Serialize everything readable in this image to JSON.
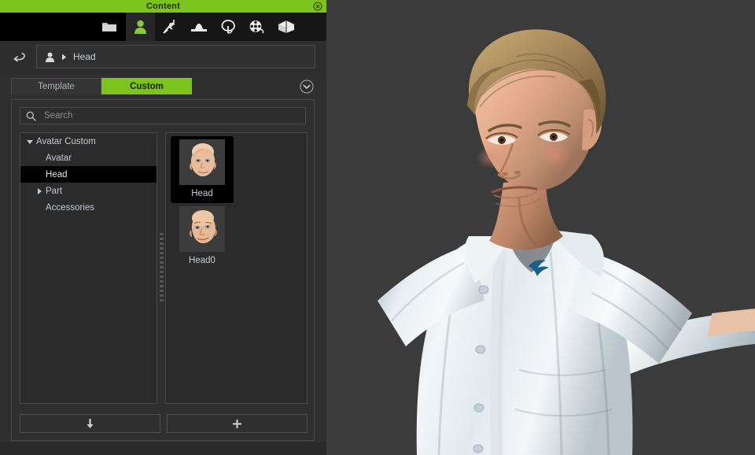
{
  "window": {
    "title": "Content",
    "close_icon": "close-circle-icon"
  },
  "toolbar": {
    "items": [
      {
        "name": "folder",
        "icon": "folder-icon",
        "label": "Folder",
        "active": false
      },
      {
        "name": "avatar",
        "icon": "person-icon",
        "label": "Avatar",
        "active": true
      },
      {
        "name": "motion",
        "icon": "motion-icon",
        "label": "Motion",
        "active": false
      },
      {
        "name": "stage",
        "icon": "stage-icon",
        "label": "Stage",
        "active": false
      },
      {
        "name": "scene",
        "icon": "tree-icon",
        "label": "Scene",
        "active": false
      },
      {
        "name": "media",
        "icon": "film-reel-icon",
        "label": "Media",
        "active": false
      },
      {
        "name": "prop",
        "icon": "prop-box-icon",
        "label": "Prop",
        "active": false
      }
    ]
  },
  "breadcrumb": {
    "back_icon": "back-arrow-icon",
    "root_icon": "person-icon",
    "separator_icon": "chevron-right-icon",
    "path": "Head"
  },
  "tabs": {
    "items": [
      {
        "label": "Template",
        "active": false
      },
      {
        "label": "Custom",
        "active": true
      }
    ],
    "toggle_icon": "chevron-down-circle-icon"
  },
  "search": {
    "icon": "search-icon",
    "value": "",
    "placeholder": "Search"
  },
  "tree": {
    "nodes": [
      {
        "label": "Avatar Custom",
        "state": "expanded",
        "depth": 0,
        "selected": false
      },
      {
        "label": "Avatar",
        "state": "leaf",
        "depth": 1,
        "selected": false
      },
      {
        "label": "Head",
        "state": "leaf",
        "depth": 1,
        "selected": true
      },
      {
        "label": "Part",
        "state": "collapsed",
        "depth": 1,
        "selected": false
      },
      {
        "label": "Accessories",
        "state": "leaf",
        "depth": 1,
        "selected": false
      }
    ]
  },
  "thumbnails": {
    "items": [
      {
        "caption": "Head",
        "selected": true,
        "icon": "head-thumbnail"
      },
      {
        "caption": "Head0",
        "selected": false,
        "icon": "head-thumbnail"
      }
    ]
  },
  "footer_buttons": {
    "items": [
      {
        "name": "load-button",
        "icon": "arrow-down-icon",
        "label": ""
      },
      {
        "name": "add-button",
        "icon": "plus-icon",
        "label": ""
      }
    ]
  },
  "viewport": {
    "background_color": "#3b3b3b",
    "character": {
      "pose": "t-pose",
      "shirt_color": "#e9eef2",
      "hair_color": "#9a7b4e",
      "skin_color": "#e2b294",
      "logo_color": "#1b5e86"
    }
  },
  "colors": {
    "accent_green": "#7cc41d",
    "panel_bg": "#2f2f2f",
    "panel_border": "#4a4a4a",
    "text_primary": "#c9cfd4",
    "selection_bg": "#000000"
  }
}
